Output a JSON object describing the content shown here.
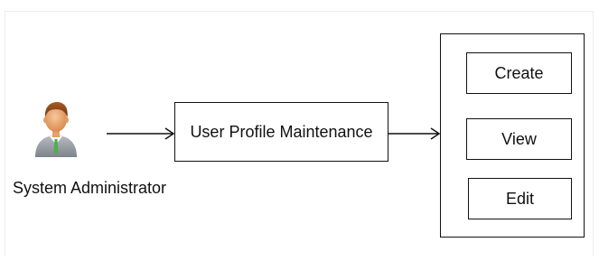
{
  "diagram": {
    "actor": {
      "label": "System Administrator",
      "icon": "user-avatar-icon"
    },
    "process": {
      "label": "User Profile Maintenance"
    },
    "operations": [
      {
        "label": "Create"
      },
      {
        "label": "View"
      },
      {
        "label": "Edit"
      }
    ]
  },
  "colors": {
    "line": "#111111",
    "background": "#ffffff",
    "frame": "#ececec",
    "avatar_shirt": "#9aa0a6",
    "avatar_skin": "#f0b07a",
    "avatar_hair": "#8a4a1c",
    "avatar_tie": "#4caf50"
  }
}
